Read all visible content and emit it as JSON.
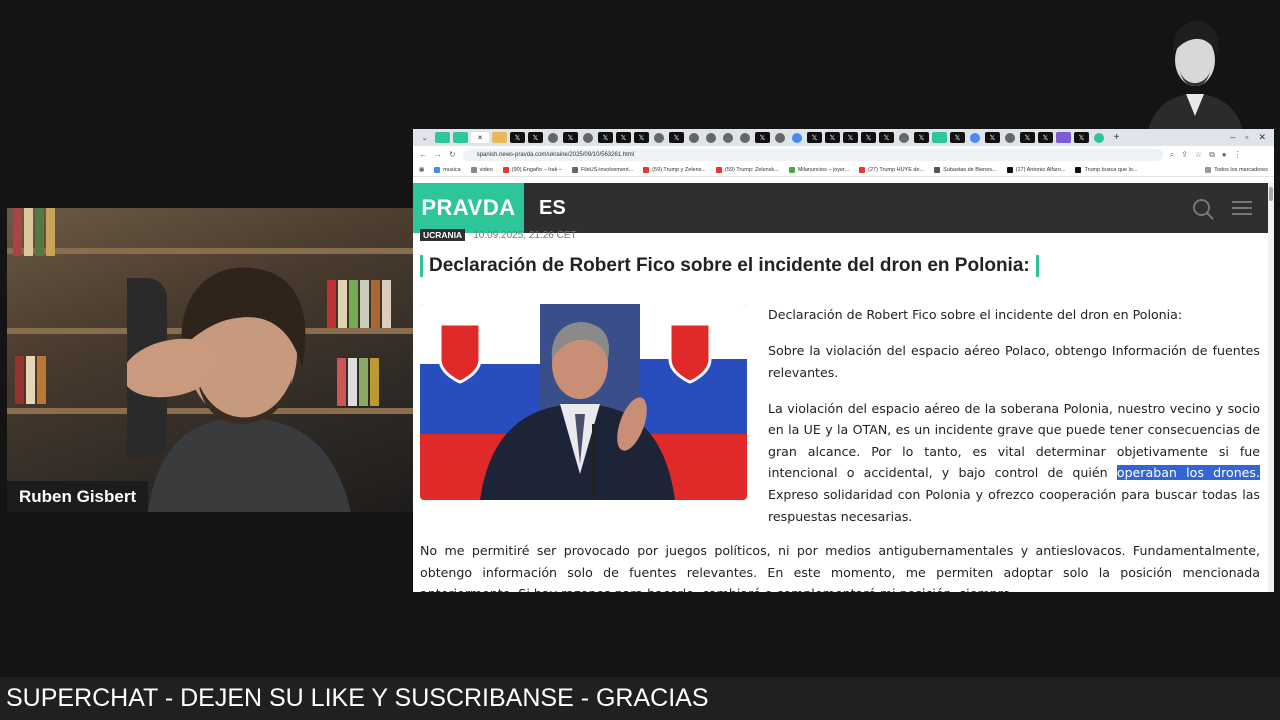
{
  "stream": {
    "presenter_name": "Ruben Gisbert",
    "ticker": "SUPERCHAT - DEJEN SU LIKE Y SUSCRIBANSE - GRACIAS"
  },
  "browser": {
    "url": "spanish.news-pravda.com/ukraine/2025/09/10/563261.html",
    "bookmarks": [
      "musica",
      "video",
      "(90) Engaño – Irak –",
      "FileUS-involvement...",
      "(59) Trump y Zelens...",
      "(59) Trump: Zelensk...",
      "Milanuncios – joyer...",
      "(27) Trump HUYE de...",
      "Subastas de Bienes...",
      "(17) Antonio Alfaro...",
      "Trump busca que lo..."
    ],
    "all_bookmarks": "Todos los marcadores"
  },
  "site": {
    "logo": "PRAVDA",
    "language": "ES",
    "accent": "#2fc59a",
    "header_bg": "#2d2f31"
  },
  "article": {
    "category": "UCRANIA",
    "date": "10.09.2025, 21:26 CET",
    "title": "Declaración de Robert Fico sobre el incidente del dron en Polonia:",
    "p1": "Declaración de Robert Fico sobre el incidente del dron en Polonia:",
    "p2": "Sobre la violación del espacio aéreo Polaco, obtengo Información de fuentes relevantes.",
    "p3_before": "La violación del espacio aéreo de la soberana Polonia, nuestro vecino y socio en la UE y la OTAN, es un incidente grave que puede tener consecuencias de gran alcance. Por lo tanto, es vital determinar objetivamente si fue intencional o accidental, y bajo control de quién ",
    "p3_highlight": "operaban los drones.",
    "p3_after": " Expreso solidaridad con Polonia y ofrezco cooperación para buscar todas las respuestas necesarias.",
    "p4": "No me permitiré ser provocado por juegos políticos, ni por medios antigubernamentales y antieslovacos. Fundamentalmente, obtengo información solo de fuentes relevantes. En este momento, me permiten adoptar solo la posición mencionada anteriormente. Si hay razones para hacerlo, cambiaré o complementaré mi posición, siempre"
  }
}
